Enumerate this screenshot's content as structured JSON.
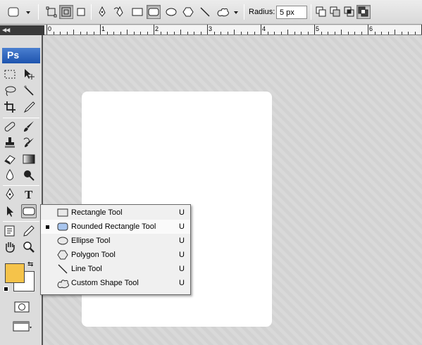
{
  "options_bar": {
    "radius_label": "Radius:",
    "radius_value": "5 px"
  },
  "toolbox": {
    "logo": "Ps",
    "foreground_color": "#f5c34a",
    "background_color": "#ffffff"
  },
  "ruler": {
    "labels": [
      "0",
      "1",
      "2",
      "3",
      "4",
      "5",
      "6"
    ]
  },
  "flyout": {
    "items": [
      {
        "label": "Rectangle Tool",
        "shortcut": "U",
        "icon": "rectangle-icon"
      },
      {
        "label": "Rounded Rectangle Tool",
        "shortcut": "U",
        "icon": "rounded-rectangle-icon",
        "selected": true
      },
      {
        "label": "Ellipse Tool",
        "shortcut": "U",
        "icon": "ellipse-icon"
      },
      {
        "label": "Polygon Tool",
        "shortcut": "U",
        "icon": "polygon-icon"
      },
      {
        "label": "Line Tool",
        "shortcut": "U",
        "icon": "line-icon"
      },
      {
        "label": "Custom Shape Tool",
        "shortcut": "U",
        "icon": "custom-shape-icon"
      }
    ]
  }
}
